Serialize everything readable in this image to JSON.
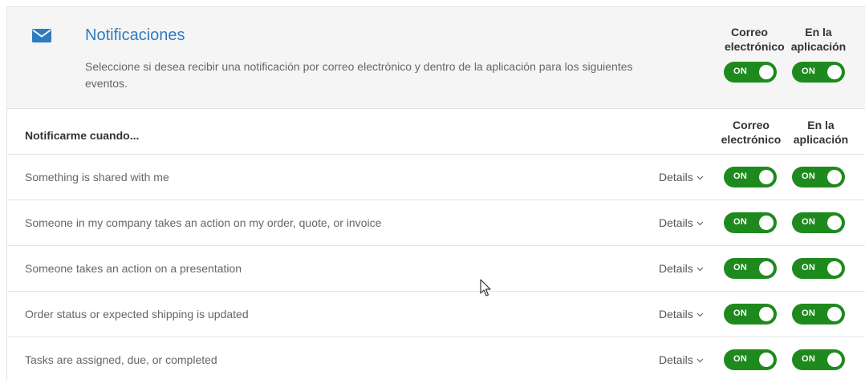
{
  "header": {
    "icon": "envelope-icon",
    "title": "Notificaciones",
    "description": "Seleccione si desea recibir una notificación por correo electrónico y dentro de la aplicación para los siguientes eventos.",
    "col_email_line1": "Correo",
    "col_email_line2": "electrónico",
    "col_app_line1": "En la",
    "col_app_line2": "aplicación",
    "email_toggle": "ON",
    "app_toggle": "ON"
  },
  "table": {
    "heading": "Notificarme cuando...",
    "col_email_line1": "Correo",
    "col_email_line2": "electrónico",
    "col_app_line1": "En la",
    "col_app_line2": "aplicación",
    "rows": [
      {
        "label": "Something is shared with me",
        "details": "Details",
        "email": "ON",
        "app": "ON"
      },
      {
        "label": "Someone in my company takes an action on my order, quote, or invoice",
        "details": "Details",
        "email": "ON",
        "app": "ON"
      },
      {
        "label": "Someone takes an action on a presentation",
        "details": "Details",
        "email": "ON",
        "app": "ON"
      },
      {
        "label": "Order status or expected shipping is updated",
        "details": "Details",
        "email": "ON",
        "app": "ON"
      },
      {
        "label": "Tasks are assigned, due, or completed",
        "details": "Details",
        "email": "ON",
        "app": "ON"
      }
    ]
  },
  "colors": {
    "accent": "#2f7bbf",
    "toggle_on": "#1e8a1e",
    "header_bg": "#f5f5f5"
  }
}
